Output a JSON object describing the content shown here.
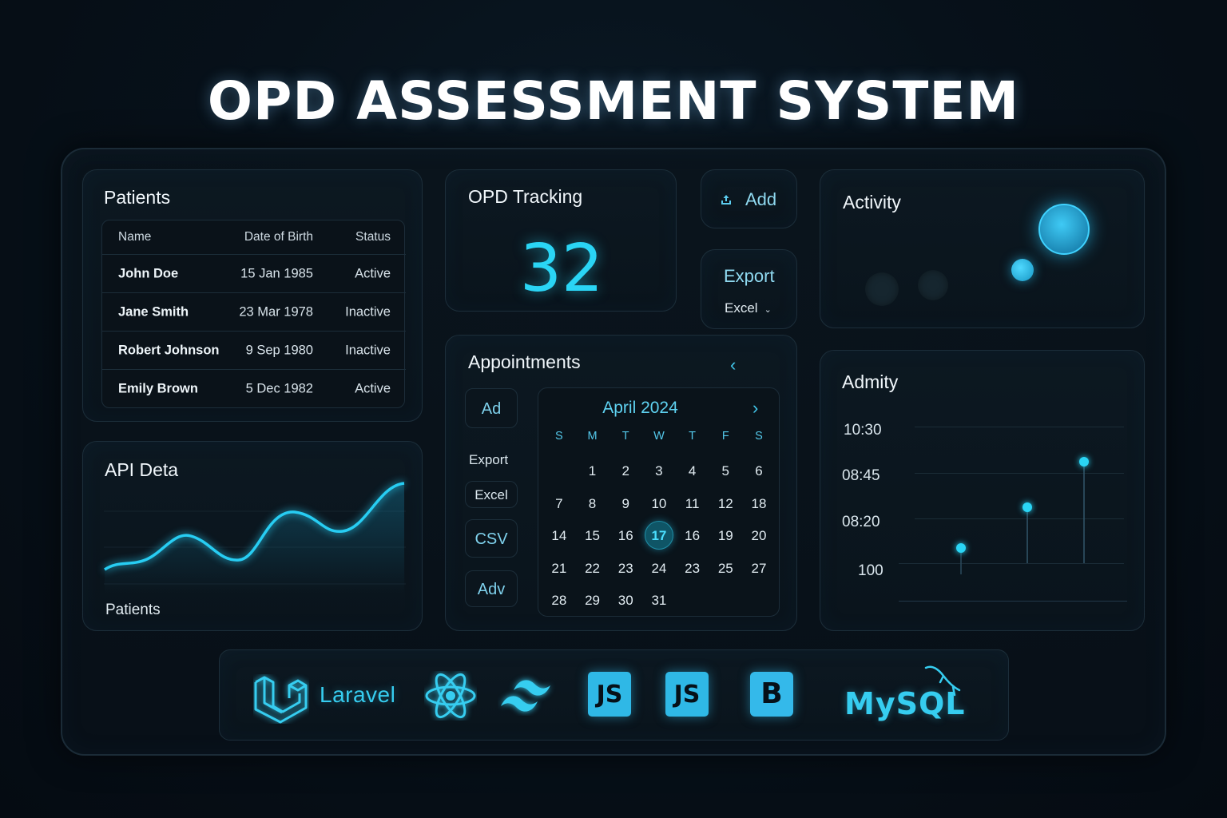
{
  "title": "OPD ASSESSMENT SYSTEM",
  "patients": {
    "title": "Patients",
    "columns": [
      "Name",
      "Date of Birth",
      "Status"
    ],
    "rows": [
      {
        "name": "John Doe",
        "dob": "15 Jan 1985",
        "status": "Active"
      },
      {
        "name": "Jane Smith",
        "dob": "23 Mar 1978",
        "status": "Inactive"
      },
      {
        "name": "Robert Johnson",
        "dob": "9 Sep 1980",
        "status": "Inactive"
      },
      {
        "name": "Emily Brown",
        "dob": "5 Dec 1982",
        "status": "Active"
      }
    ]
  },
  "tracking": {
    "title": "OPD Tracking",
    "value": "32"
  },
  "actions": {
    "add_label": "Add",
    "export_label": "Export",
    "excel_label": "Excel"
  },
  "appointments": {
    "title": "Appointments",
    "side": {
      "ad": "Ad",
      "export": "Export",
      "excel": "Excel",
      "csv": "CSV",
      "adv": "Adv"
    },
    "calendar": {
      "month": "April 2024",
      "weekdays": [
        "S",
        "M",
        "T",
        "W",
        "T",
        "F",
        "S"
      ],
      "weeks": [
        [
          "",
          "1",
          "2",
          "3",
          "4",
          "5",
          "6"
        ],
        [
          "7",
          "8",
          "9",
          "10",
          "11",
          "12",
          "18"
        ],
        [
          "14",
          "15",
          "16",
          "17",
          "16",
          "19",
          "20"
        ],
        [
          "21",
          "22",
          "23",
          "24",
          "23",
          "25",
          "27"
        ],
        [
          "28",
          "29",
          "30",
          "31",
          "",
          "",
          ""
        ]
      ],
      "selected": "17"
    }
  },
  "activity": {
    "title": "Activity"
  },
  "admity": {
    "title": "Admity",
    "y_ticks": [
      "10:30",
      "08:45",
      "08:20",
      "100"
    ],
    "accent": "#2ad5f5"
  },
  "api": {
    "title": "API Deta",
    "footer": "Patients"
  },
  "tech": {
    "laravel": "Laravel",
    "js1": "JS",
    "js2": "JS",
    "bootstrap": "B",
    "mysql": "MySQL"
  },
  "colors": {
    "accent": "#2ad5f5",
    "background": "#07111a",
    "border": "#1c2e3a"
  }
}
